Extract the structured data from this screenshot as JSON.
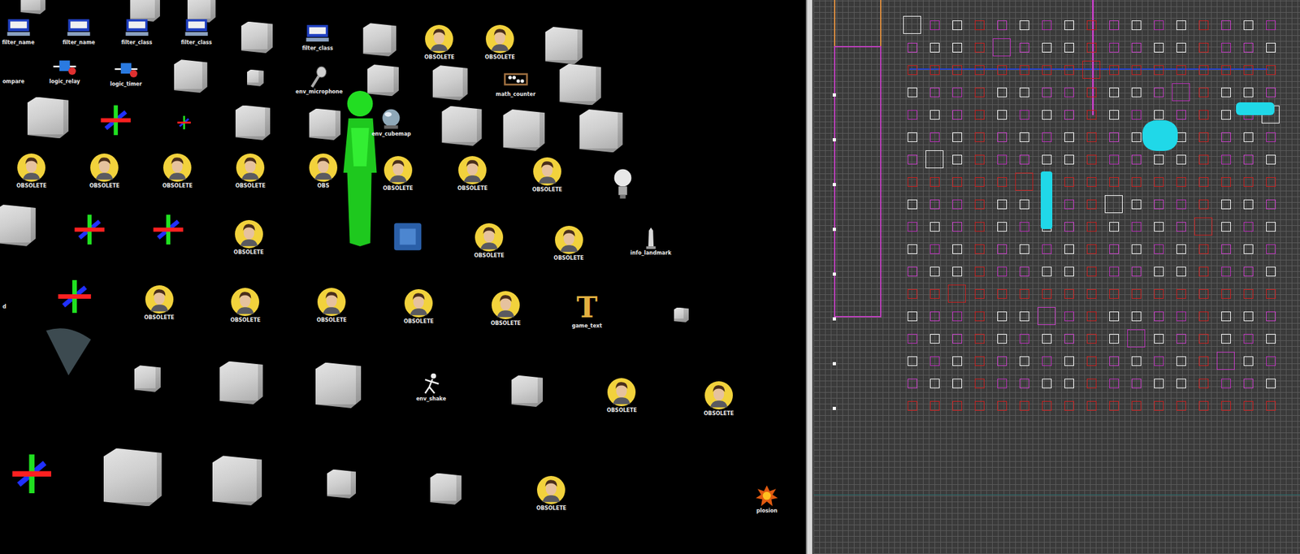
{
  "viewport3d": {
    "entities": [
      {
        "label": "filter_name",
        "kind": "filter"
      },
      {
        "label": "filter_name",
        "kind": "filter"
      },
      {
        "label": "filter_class",
        "kind": "filter"
      },
      {
        "label": "filter_class",
        "kind": "filter"
      },
      {
        "label": "filter_class",
        "kind": "filter"
      },
      {
        "label": "OBSOLETE",
        "kind": "obsolete"
      },
      {
        "label": "OBSOLETE",
        "kind": "obsolete"
      },
      {
        "label": "ompare",
        "kind": "cut"
      },
      {
        "label": "logic_relay",
        "kind": "logic"
      },
      {
        "label": "logic_timer",
        "kind": "logic"
      },
      {
        "label": "env_microphone",
        "kind": "microphone"
      },
      {
        "label": "math_counter",
        "kind": "counter"
      },
      {
        "label": "env_cubemap",
        "kind": "cubemap"
      },
      {
        "label": "OBSOLETE",
        "kind": "obsolete"
      },
      {
        "label": "OBSOLETE",
        "kind": "obsolete"
      },
      {
        "label": "OBSOLETE",
        "kind": "obsolete"
      },
      {
        "label": "OBSOLETE",
        "kind": "obsolete"
      },
      {
        "label": "OBS",
        "kind": "obsolete"
      },
      {
        "label": "OBSOLETE",
        "kind": "obsolete"
      },
      {
        "label": "OBSOLETE",
        "kind": "obsolete"
      },
      {
        "label": "OBSOLETE",
        "kind": "obsolete"
      },
      {
        "label": "OBSOLETE",
        "kind": "obsolete"
      },
      {
        "label": "OBSOLETE",
        "kind": "obsolete"
      },
      {
        "label": "OBSOLETE",
        "kind": "obsolete"
      },
      {
        "label": "info_landmark",
        "kind": "landmark"
      },
      {
        "label": "d",
        "kind": "cut"
      },
      {
        "label": "OBSOLETE",
        "kind": "obsolete"
      },
      {
        "label": "OBSOLETE",
        "kind": "obsolete"
      },
      {
        "label": "OBSOLETE",
        "kind": "obsolete"
      },
      {
        "label": "OBSOLETE",
        "kind": "obsolete"
      },
      {
        "label": "OBSOLETE",
        "kind": "obsolete"
      },
      {
        "label": "game_text",
        "kind": "text",
        "glyph": "T"
      },
      {
        "label": "env_shake",
        "kind": "shake"
      },
      {
        "label": "OBSOLETE",
        "kind": "obsolete"
      },
      {
        "label": "OBSOLETE",
        "kind": "obsolete"
      },
      {
        "label": "OBSOLETE",
        "kind": "obsolete"
      },
      {
        "label": "plosion",
        "kind": "explosion"
      }
    ]
  }
}
